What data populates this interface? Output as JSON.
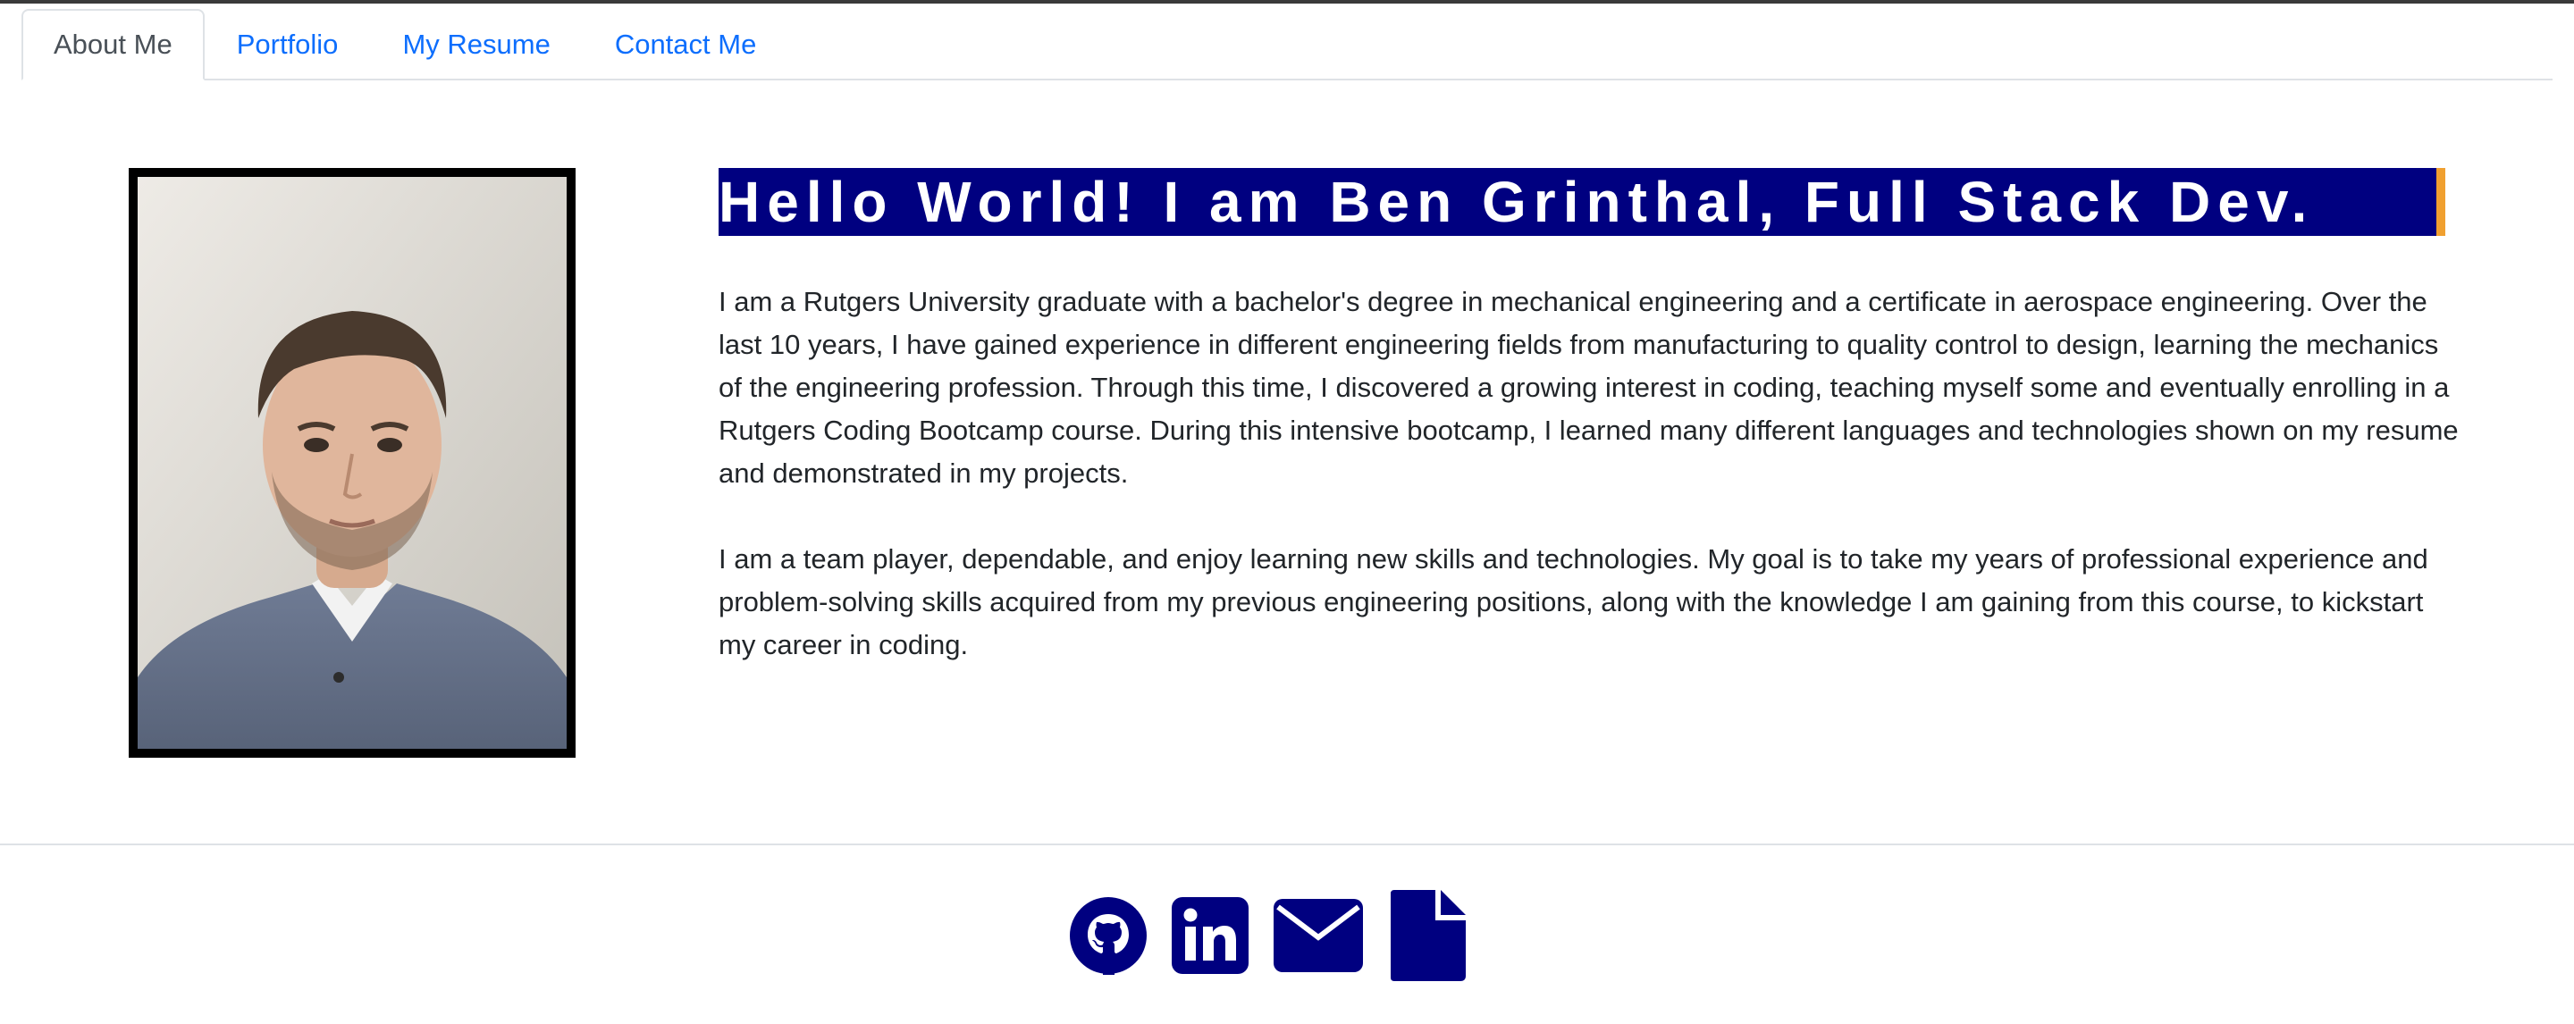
{
  "nav": {
    "tabs": [
      {
        "label": "About Me",
        "active": true
      },
      {
        "label": "Portfolio",
        "active": false
      },
      {
        "label": "My Resume",
        "active": false
      },
      {
        "label": "Contact Me",
        "active": false
      }
    ]
  },
  "about": {
    "heading": "Hello World! I am Ben Grinthal, Full Stack Dev.",
    "paragraphs": [
      "I am a Rutgers University graduate with a bachelor's degree in mechanical engineering and a certificate in aerospace engineering. Over the last 10 years, I have gained experience in different engineering fields from manufacturing to quality control to design, learning the mechanics of the engineering profession. Through this time, I discovered a growing interest in coding, teaching myself some and eventually enrolling in a Rutgers Coding Bootcamp course. During this intensive bootcamp, I learned many different languages and technologies shown on my resume and demonstrated in my projects.",
      "I am a team player, dependable, and enjoy learning new skills and technologies. My goal is to take my years of professional experience and problem-solving skills acquired from my previous engineering positions, along with the knowledge I am gaining from this course, to kickstart my career in coding."
    ]
  },
  "footer": {
    "icons": [
      "github-icon",
      "linkedin-icon",
      "email-icon",
      "resume-document-icon"
    ]
  },
  "colors": {
    "accent": "#000080",
    "heading_border": "#f0a030",
    "link": "#0d6efd"
  }
}
